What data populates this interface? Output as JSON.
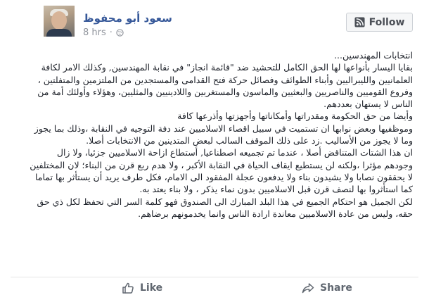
{
  "post": {
    "author": "سعود أبو محفوظ",
    "time": "8 hrs",
    "separator": "·",
    "follow_label": "Follow",
    "body_lines": [
      "انتخابات المهندسين...",
      "بقايا اليسار بأنواعها لها الحق الكامل للتحشيد ضد \"قائمة انجاز\" في نقابة المهندسين, وكذلك الامر لكافة",
      "العلمانيين والليبراليين وأبناء الطوائف وفصائل حركة فتح القدامى والمستجدين من الملتزمين والمتفلتين ،",
      "وفروع القوميين والناصريين والبعثيين والماسون والمستغربين واللادينيين والمثليين، وهؤلاء وأولئك أمة من",
      "الناس لا يستهان بعددهم.",
      "وأيضا من حق الحكومة ومقدراتها وأمكاناتها وأجهزتها وأذرعها كافة",
      "وموظفيها وبعض نوابها ان تستميت في سبيل اقصاء الاسلاميين عند دفة التوجيه في النقابة ،وذلك بما يجوز",
      "وما لا يجوز من الأساليب .زد على ذلك الموقف السالب لبعض المتدينين من الانتخابات أصلا.",
      "ان هذا الشتات المتناقض أصلا ، عندما تم تجميعه اصطناعيا, أستطاع ازاحة الاسلاميين جزئيا، ولا زال",
      "وجودهم مؤثرا ،ولكنه لن يستطيع ايقاف الحياة في النقابة الأكبر ، ولا هدم ربع قرن من البناء؛ لان المختلفين",
      "لا يحققون نصابا ولا يشيدون بناء ولا يدفعون عجلة المفقود الى الامام، فكل طرف يريد أن يستأثر بها تماما",
      "كما استأثروا بها لنصف قرن قبل الاسلاميين بدون نماء يذكر ، ولا بناء يعتد به.",
      "لكن الجميل هو احتكام الجميع في هذا البلد المبارك الى الصندوق فهو كلمة السر التي تحفظ لكل ذي حق",
      "حقه، وليس من عادة الاسلاميين معاندة ارادة الناس وانما يخدمونهم برضاهم."
    ],
    "actions": {
      "like_label": "Like",
      "share_label": "Share"
    }
  },
  "icons": {
    "follow": "rss-follow-icon",
    "privacy": "globe-icon",
    "like": "thumbs-up-icon",
    "share": "share-arrow-icon"
  },
  "colors": {
    "author": "#365899",
    "meta": "#90949c",
    "text": "#1d2129",
    "action": "#606770",
    "button_border": "#ccd0d5"
  }
}
